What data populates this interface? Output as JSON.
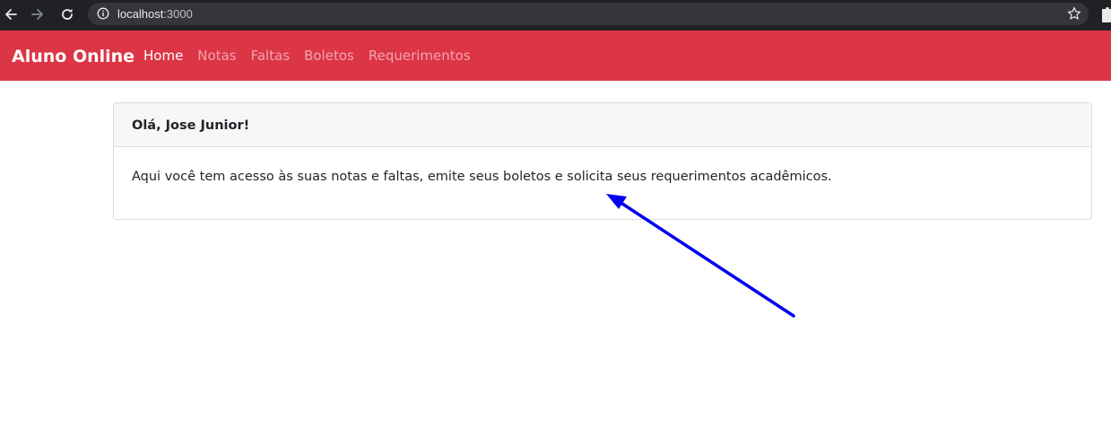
{
  "browser": {
    "url_host": "localhost",
    "url_port": ":3000",
    "icons": [
      "back-arrow-icon",
      "forward-arrow-icon",
      "reload-icon",
      "info-icon",
      "star-icon",
      "extensions-puzzle-icon"
    ]
  },
  "navbar": {
    "brand": "Aluno Online",
    "links": [
      {
        "label": "Home",
        "active": true
      },
      {
        "label": "Notas",
        "active": false
      },
      {
        "label": "Faltas",
        "active": false
      },
      {
        "label": "Boletos",
        "active": false
      },
      {
        "label": "Requerimentos",
        "active": false
      }
    ],
    "background_color": "#dc3545"
  },
  "card": {
    "title": "Olá, Jose Junior!",
    "text": "Aqui você tem acesso às suas notas e faltas, emite seus boletos e solicita seus requerimentos acadêmicos."
  },
  "annotation": {
    "color": "#0000ee"
  }
}
